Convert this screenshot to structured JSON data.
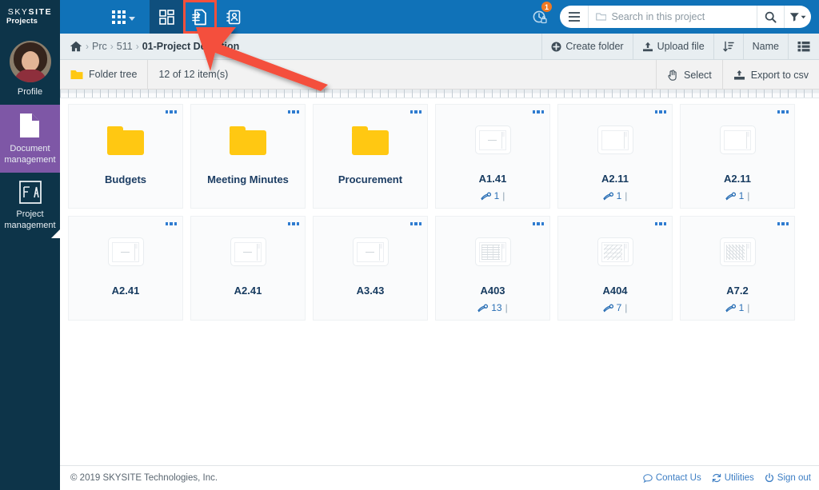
{
  "app": {
    "logo_primary": "SKY",
    "logo_bold": "SITE",
    "logo_trademark": "®",
    "logo_sub": "Projects"
  },
  "topbar": {
    "apps_menu_name": "apps-grid",
    "nav": [
      {
        "name": "dashboard-icon",
        "label": "Dashboard",
        "state": "dark"
      },
      {
        "name": "document-management-icon",
        "label": "Document management",
        "state": "highlighted"
      },
      {
        "name": "contacts-icon",
        "label": "Contacts",
        "state": "normal"
      }
    ],
    "history": {
      "icon": "history-lock-icon",
      "badge": "1"
    },
    "search": {
      "menu_icon": "hamburger-icon",
      "folder_icon": "folder-icon",
      "placeholder": "Search in this project",
      "value": "",
      "search_icon": "magnifier-icon",
      "filter_icon": "filter-icon"
    }
  },
  "sidebar": {
    "items": [
      {
        "name": "profile",
        "label": "Profile",
        "icon": "avatar",
        "active": false
      },
      {
        "name": "document-management",
        "label": "Document\nmanagement",
        "label_l1": "Document",
        "label_l2": "management",
        "icon": "document-icon",
        "active": true
      },
      {
        "name": "project-management",
        "label": "Project management",
        "label_l1": "Project",
        "label_l2": "management",
        "icon": "blueprint-icon",
        "active": false
      }
    ]
  },
  "breadcrumb": {
    "home_icon": "home-icon",
    "items": [
      "Prc",
      "511",
      "01-Project Definition"
    ],
    "separator": "›"
  },
  "toolbar": {
    "create_folder": "Create folder",
    "upload_file": "Upload file",
    "sort_icon": "sort-icon",
    "sort_field": "Name",
    "view_icon": "list-view-icon"
  },
  "subbar": {
    "folder_tree": "Folder tree",
    "item_count": "12 of 12 item(s)",
    "select": "Select",
    "export_csv": "Export to csv"
  },
  "items": [
    {
      "name": "Budgets",
      "type": "folder",
      "pages": null
    },
    {
      "name": "Meeting Minutes",
      "type": "folder",
      "pages": null
    },
    {
      "name": "Procurement",
      "type": "folder",
      "pages": null
    },
    {
      "name": "A1.41",
      "type": "file",
      "pages": "1",
      "thumb": "plain"
    },
    {
      "name": "A2.11",
      "type": "file",
      "pages": "1",
      "thumb": "plain"
    },
    {
      "name": "A2.11",
      "type": "file",
      "pages": "1",
      "thumb": "plain"
    },
    {
      "name": "A2.41",
      "type": "file",
      "pages": null,
      "thumb": "plain"
    },
    {
      "name": "A2.41",
      "type": "file",
      "pages": null,
      "thumb": "plain"
    },
    {
      "name": "A3.43",
      "type": "file",
      "pages": null,
      "thumb": "plain"
    },
    {
      "name": "A403",
      "type": "file",
      "pages": "13",
      "thumb": "dense"
    },
    {
      "name": "A404",
      "type": "file",
      "pages": "7",
      "thumb": "dense2"
    },
    {
      "name": "A7.2",
      "type": "file",
      "pages": "1",
      "thumb": "dense3"
    }
  ],
  "footer": {
    "copyright": "© 2019 SKYSITE Technologies, Inc.",
    "links": [
      {
        "name": "contact-us",
        "label": "Contact Us",
        "icon": "chat-icon"
      },
      {
        "name": "utilities",
        "label": "Utilities",
        "icon": "refresh-icon"
      },
      {
        "name": "sign-out",
        "label": "Sign out",
        "icon": "power-icon"
      }
    ]
  },
  "annotation": {
    "type": "red-arrow",
    "points_to": "document-management-icon",
    "color": "#f4503c"
  },
  "colors": {
    "topbar": "#1072b8",
    "sidebar": "#0d3449",
    "active_sidebar": "#7e57a6",
    "folder": "#ffc812",
    "accent_link": "#2a6fb5",
    "annotation": "#f4503c",
    "badge": "#f07922"
  }
}
